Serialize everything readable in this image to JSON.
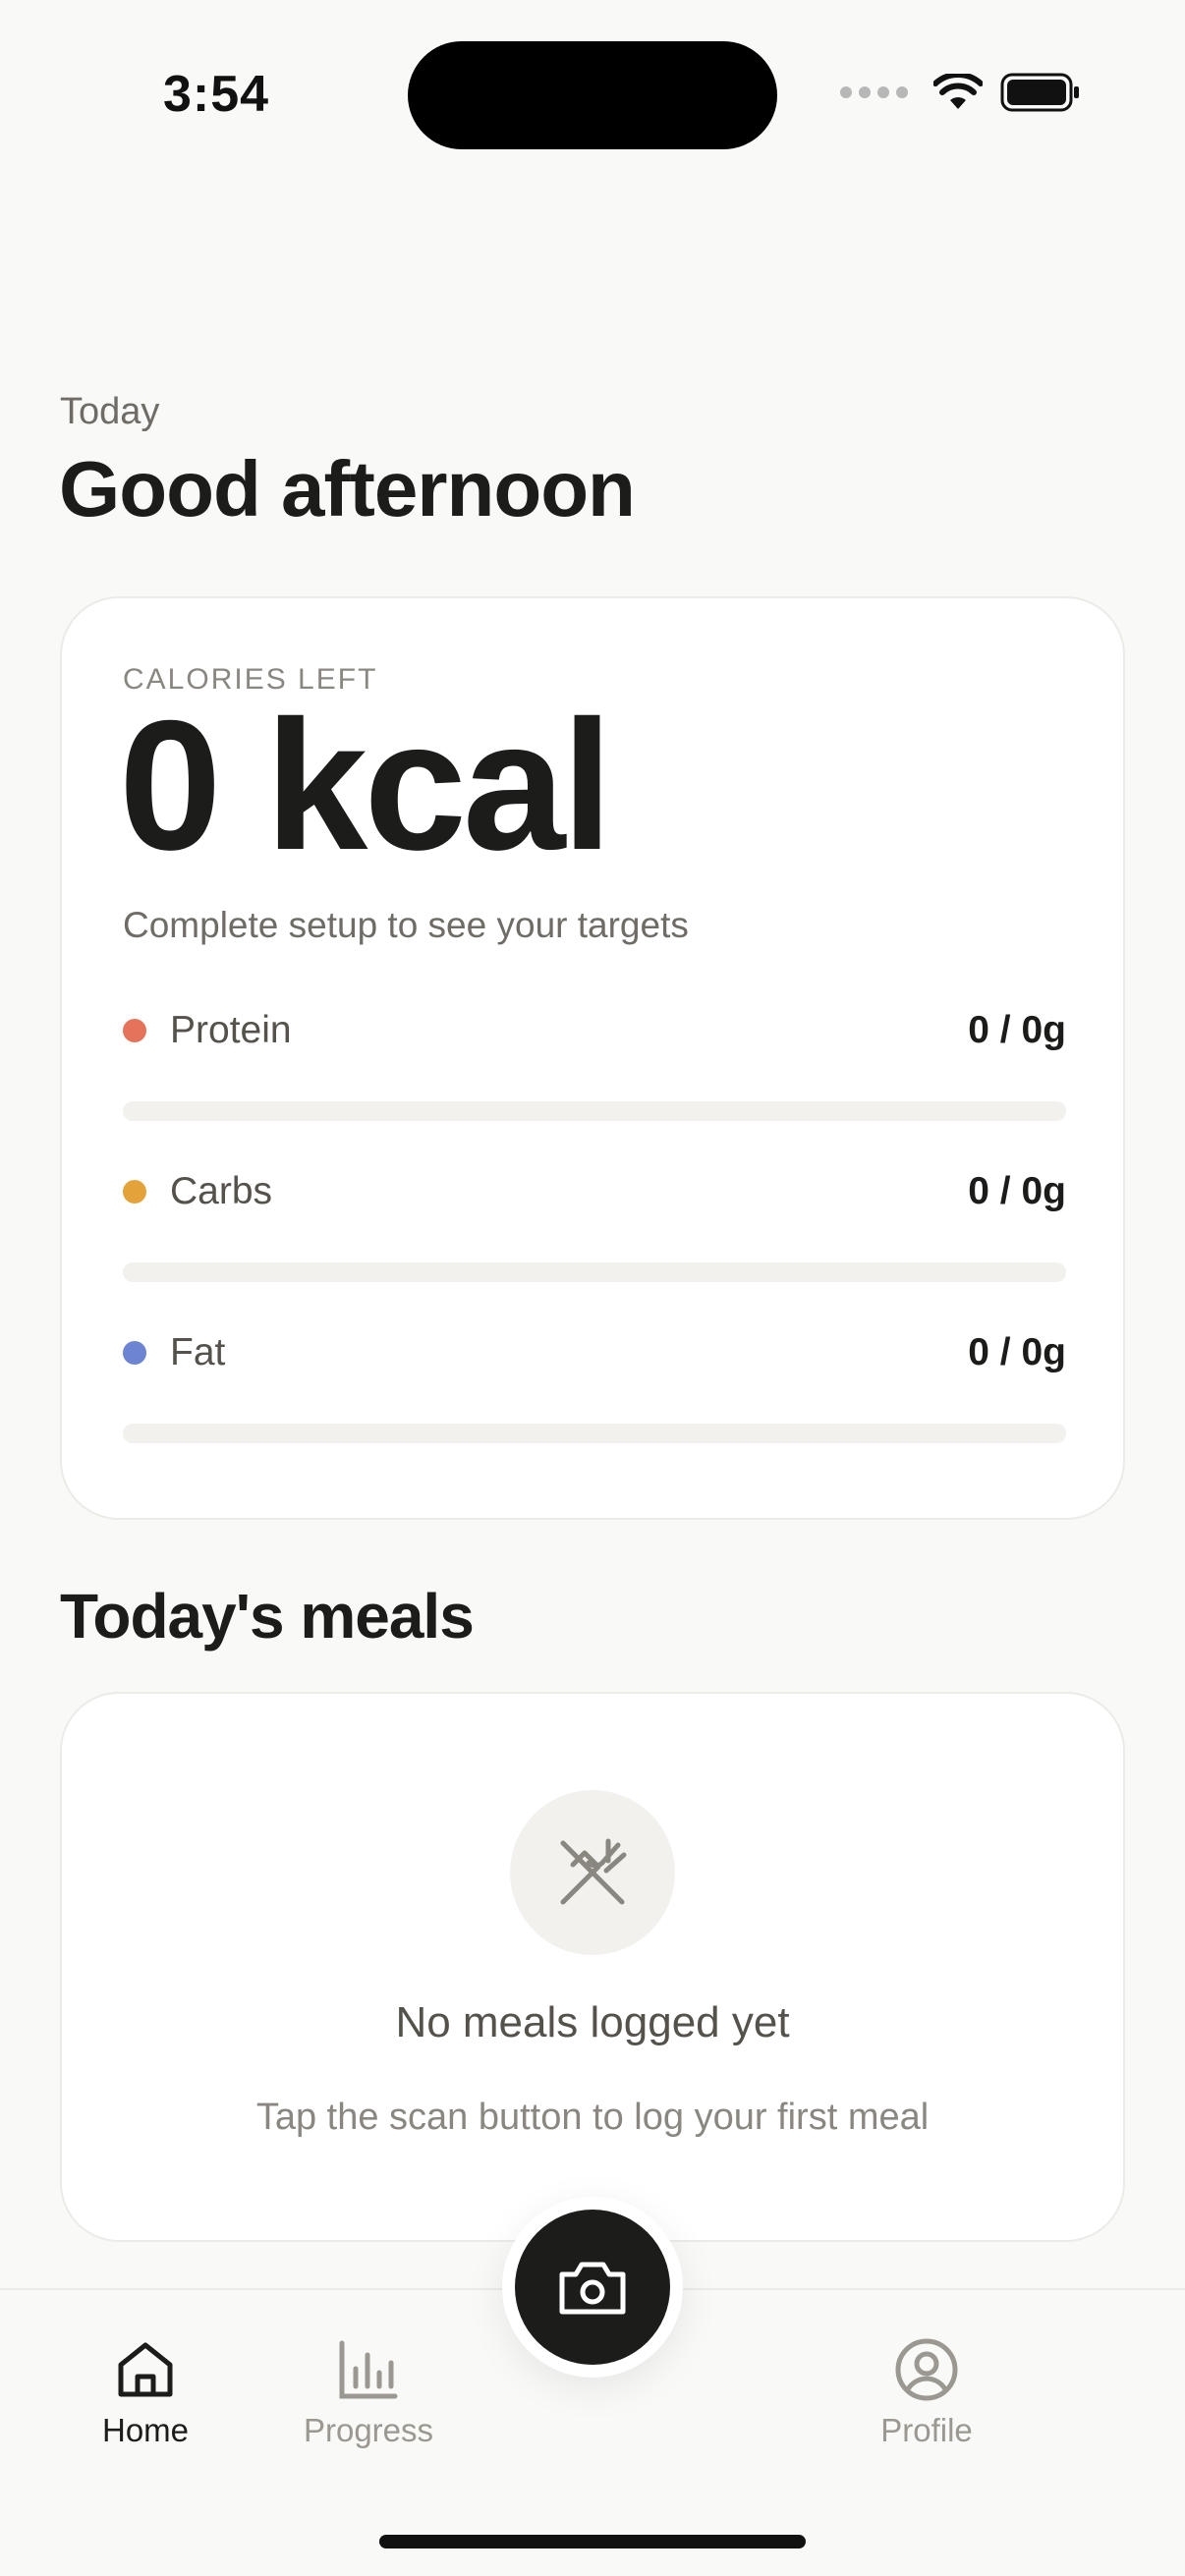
{
  "status_bar": {
    "time": "3:54"
  },
  "header": {
    "subtitle": "Today",
    "title": "Good afternoon"
  },
  "calories": {
    "label": "CALORIES LEFT",
    "value": "0 kcal",
    "hint": "Complete setup to see your targets"
  },
  "macros": [
    {
      "name": "Protein",
      "value": "0 / 0g",
      "progress": 0,
      "color": "#e4735a"
    },
    {
      "name": "Carbs",
      "value": "0 / 0g",
      "progress": 0,
      "color": "#e3a33a"
    },
    {
      "name": "Fat",
      "value": "0 / 0g",
      "progress": 0,
      "color": "#6d84d2"
    }
  ],
  "meals": {
    "title": "Today's meals",
    "empty_icon": "utensils-crossed-icon",
    "empty_title": "No meals logged yet",
    "empty_hint": "Tap the scan button to log your first meal"
  },
  "tabbar": {
    "items": [
      {
        "label": "Home",
        "icon": "home-icon",
        "active": true
      },
      {
        "label": "Progress",
        "icon": "bar-chart-icon",
        "active": false
      },
      {
        "label": "Profile",
        "icon": "user-circle-icon",
        "active": false
      }
    ],
    "scan_icon": "camera-icon"
  },
  "colors": {
    "accent": "#1c1c1a",
    "background": "#f9f9f8",
    "card": "#ffffff"
  }
}
